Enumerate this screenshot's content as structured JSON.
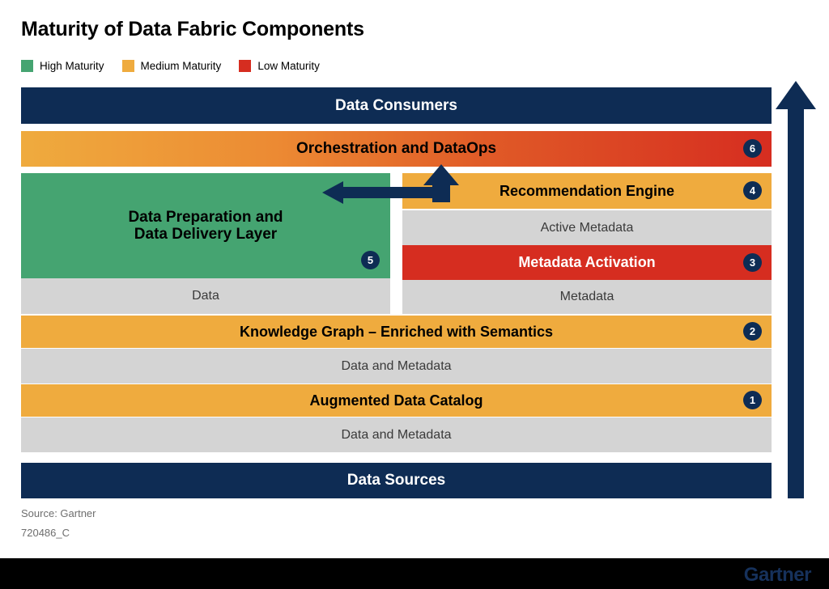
{
  "header": {
    "title": "Maturity of Data Fabric Components"
  },
  "legend": {
    "items": [
      {
        "label": "High Maturity",
        "color": "#45A471",
        "icon": "green-square-swatch"
      },
      {
        "label": "Medium Maturity",
        "color": "#EFAB3E",
        "icon": "amber-square-swatch"
      },
      {
        "label": "Low Maturity",
        "color": "#D62D20",
        "icon": "red-square-swatch"
      }
    ]
  },
  "diagram": {
    "consumers_bar": {
      "label": "Data Consumers",
      "color": "#0E2C54"
    },
    "orchestration_bar": {
      "label": "Orchestration and DataOps",
      "badge": "6",
      "gradient_from": "#EFAB3E",
      "gradient_to": "#D62D20"
    },
    "left_column": {
      "block": {
        "line1": "Data Preparation and",
        "line2": "Data Delivery Layer",
        "badge": "5",
        "color": "#45A471"
      },
      "substrate": {
        "label": "Data",
        "color": "#D4D4D4"
      }
    },
    "right_column": {
      "recommendation_bar": {
        "label": "Recommendation Engine",
        "badge": "4",
        "color": "#EFAB3E"
      },
      "active_metadata_bar": {
        "label": "Active Metadata",
        "color": "#D4D4D4"
      },
      "metadata_activation_bar": {
        "label": "Metadata Activation",
        "badge": "3",
        "color": "#D62D20"
      },
      "metadata_bar": {
        "label": "Metadata",
        "color": "#D4D4D4"
      }
    },
    "knowledge_graph_bar": {
      "label": "Knowledge Graph – Enriched with Semantics",
      "badge": "2",
      "color": "#EFAB3E"
    },
    "knowledge_graph_substrate": {
      "label": "Data and Metadata",
      "color": "#D4D4D4"
    },
    "catalog_bar": {
      "label": "Augmented Data Catalog",
      "badge": "1",
      "color": "#EFAB3E"
    },
    "catalog_substrate": {
      "label": "Data and Metadata",
      "color": "#D4D4D4"
    },
    "sources_bar": {
      "label": "Data Sources",
      "color": "#0E2C54"
    },
    "arrows": {
      "maturity_arrow": {
        "name": "upward-maturity-arrow",
        "color": "#0E2C54",
        "direction": "up"
      },
      "feedback_arrow": {
        "name": "elbow-feedback-arrow",
        "color": "#0E2C54",
        "direction": "left-and-up"
      }
    }
  },
  "footer": {
    "source": "Source: Gartner",
    "doc_id": "720486_C",
    "logo": "Gartner"
  }
}
